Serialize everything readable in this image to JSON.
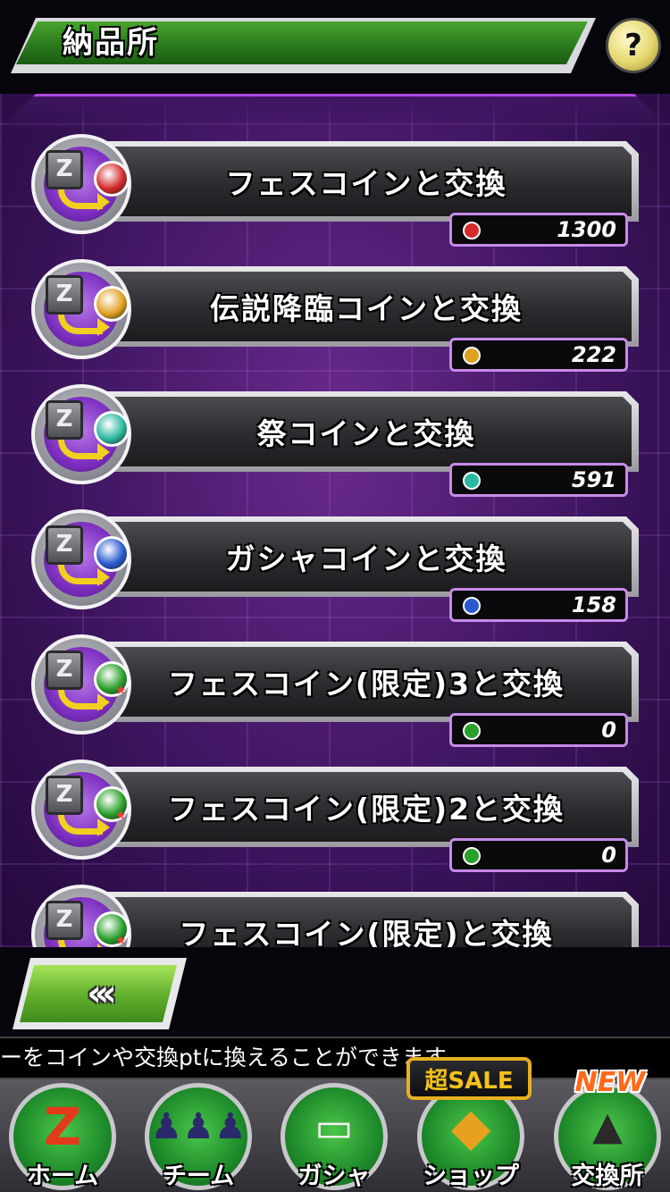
{
  "header": {
    "title": "納品所",
    "help_label": "?"
  },
  "exchange_rows": [
    {
      "label": "フェスコイン と 交換",
      "display": "フェスコインと交換",
      "count": "1300",
      "coin_color": "#d42a2a",
      "limited": false
    },
    {
      "label": "伝説降臨コインと交換",
      "count": "222",
      "coin_color": "#e0a020",
      "limited": false
    },
    {
      "label": "祭コインと交換",
      "count": "591",
      "coin_color": "#2ab8a0",
      "limited": false
    },
    {
      "label": "ガシャコインと交換",
      "count": "158",
      "coin_color": "#2a5ad0",
      "limited": false
    },
    {
      "label": "フェスコイン(限定)3と交換",
      "count": "0",
      "coin_color": "#2aa02a",
      "limited": true
    },
    {
      "label": "フェスコイン(限定)2と交換",
      "count": "0",
      "coin_color": "#2aa02a",
      "limited": true
    },
    {
      "label": "フェスコイン(限定)と交換",
      "count": "",
      "coin_color": "#2aa02a",
      "limited": true
    }
  ],
  "back_button": {
    "label": "‹‹‹"
  },
  "ticker": {
    "text": "ーをコインや交換ptに換えることができます"
  },
  "nav": {
    "items": [
      {
        "label": "ホーム",
        "icon": "z-logo-icon"
      },
      {
        "label": "チーム",
        "icon": "team-icon"
      },
      {
        "label": "ガシャ",
        "icon": "gasha-icon"
      },
      {
        "label": "ショップ",
        "icon": "shop-icon"
      },
      {
        "label": "交換所",
        "icon": "exchange-icon"
      }
    ],
    "sale_badge": "超SALE",
    "new_badge": "NEW"
  },
  "colors": {
    "accent_green": "#2a7a1c",
    "panel_purple": "#3e1560",
    "count_border": "#c88ae8"
  }
}
